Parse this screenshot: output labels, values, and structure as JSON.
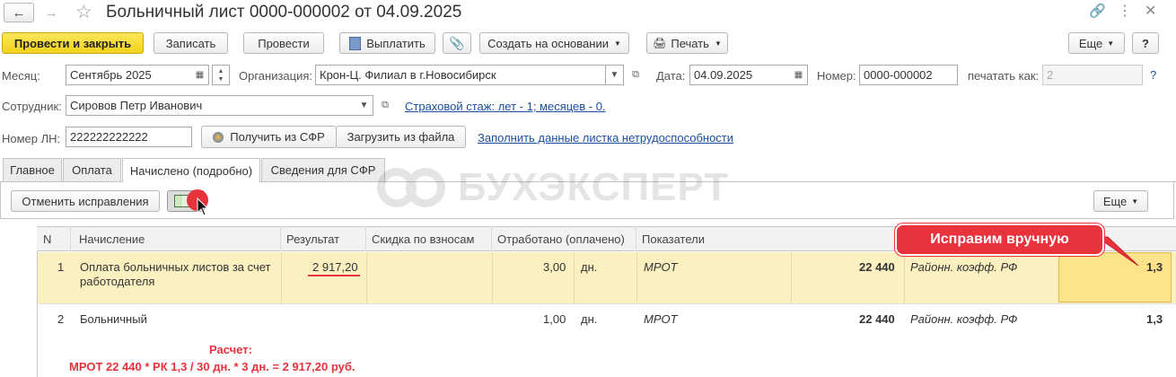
{
  "window": {
    "title": "Больничный лист 0000-000002 от 04.09.2025"
  },
  "toolbar": {
    "post_close": "Провести и закрыть",
    "save": "Записать",
    "post": "Провести",
    "pay": "Выплатить",
    "create_based": "Создать на основании",
    "print": "Печать",
    "more": "Еще",
    "help": "?"
  },
  "form": {
    "month_label": "Месяц:",
    "month_value": "Сентябрь 2025",
    "org_label": "Организация:",
    "org_value": "Крон-Ц. Филиал в г.Новосибирск",
    "date_label": "Дата:",
    "date_value": "04.09.2025",
    "number_label": "Номер:",
    "number_value": "0000-000002",
    "print_as_label": "печатать как:",
    "print_as_value": "2",
    "help": "?",
    "employee_label": "Сотрудник:",
    "employee_value": "Сировов Петр Иванович",
    "insurance_link": "Страховой стаж: лет - 1; месяцев - 0.",
    "ln_label": "Номер ЛН:",
    "ln_value": "222222222222",
    "get_sfr": "Получить из СФР",
    "load_file": "Загрузить из файла",
    "fill_link": "Заполнить данные листка нетрудоспособности"
  },
  "tabs": [
    "Главное",
    "Оплата",
    "Начислено (подробно)",
    "Сведения для СФР"
  ],
  "tab_toolbar": {
    "cancel_fix": "Отменить исправления",
    "more": "Еще"
  },
  "watermark": "БУХЭКСПЕРТ",
  "table": {
    "headers": [
      "N",
      "Начисление",
      "Результат",
      "Скидка по взносам",
      "Отработано (оплачено)",
      "Показатели"
    ],
    "rows": [
      {
        "n": "1",
        "accrual_line1": "Оплата больничных листов за счет",
        "accrual_line2": "работодателя",
        "result": "2 917,20",
        "worked": "3,00",
        "unit": "дн.",
        "ind1_name": "МРОТ",
        "ind1_value": "22 440",
        "ind2_name": "Районн. коэфф. РФ",
        "ind2_value": "1,3"
      },
      {
        "n": "2",
        "accrual_line1": "Больничный",
        "accrual_line2": "",
        "result": "",
        "worked": "1,00",
        "unit": "дн.",
        "ind1_name": "МРОТ",
        "ind1_value": "22 440",
        "ind2_name": "Районн. коэфф. РФ",
        "ind2_value": "1,3"
      }
    ]
  },
  "annotations": {
    "callout": "Исправим вручную",
    "calc_title": "Расчет:",
    "calc_formula": "МРОТ 22 440 * РК 1,3 / 30 дн. * 3 дн. = 2 917,20 руб."
  },
  "colors": {
    "primary_button": "#f5d92a",
    "selected_row": "#fbf1c0",
    "selected_cell": "#fde38a",
    "annotation_red": "#e8323c",
    "link_blue": "#1a4fa0"
  }
}
